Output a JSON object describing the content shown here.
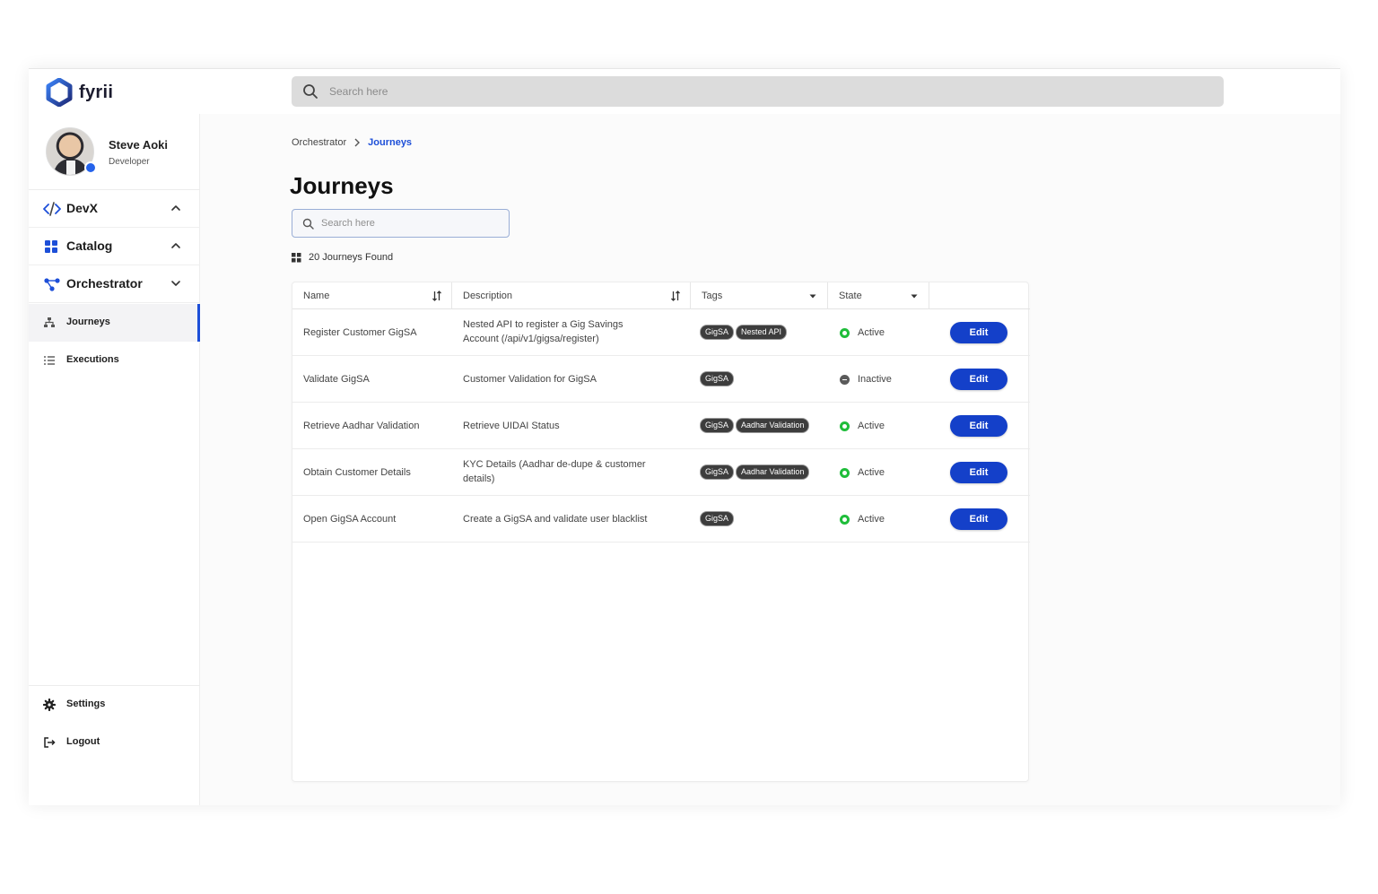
{
  "app": {
    "name": "fyrii"
  },
  "header": {
    "search_placeholder": "Search here"
  },
  "profile": {
    "name": "Steve Aoki",
    "role": "Developer"
  },
  "sidebar": {
    "groups": [
      {
        "label": "DevX",
        "icon": "code-icon",
        "expanded": true
      },
      {
        "label": "Catalog",
        "icon": "grid-icon",
        "expanded": true
      },
      {
        "label": "Orchestrator",
        "icon": "workflow-icon",
        "expanded": false
      }
    ],
    "items": [
      {
        "label": "Journeys",
        "icon": "hierarchy-icon",
        "active": true
      },
      {
        "label": "Executions",
        "icon": "list-icon",
        "active": false
      }
    ],
    "bottom": [
      {
        "label": "Settings",
        "icon": "gear-icon"
      },
      {
        "label": "Logout",
        "icon": "logout-icon"
      }
    ]
  },
  "breadcrumb": {
    "parent": "Orchestrator",
    "separator": ">",
    "current": "Journeys"
  },
  "page": {
    "title": "Journeys",
    "search_placeholder": "Search here",
    "count_text": "20 Journeys Found"
  },
  "table": {
    "columns": [
      "Name",
      "Description",
      "Tags",
      "State",
      ""
    ],
    "edit_label": "Edit",
    "rows": [
      {
        "name": "Register Customer GigSA",
        "description_lines": [
          "Nested API to register a Gig Savings",
          "Account (/api/v1/gigsa/register)"
        ],
        "tags": [
          "GigSA",
          "Nested API"
        ],
        "state": "Active"
      },
      {
        "name": "Validate GigSA",
        "description_lines": [
          "Customer Validation for GigSA"
        ],
        "tags": [
          "GigSA"
        ],
        "state": "Inactive"
      },
      {
        "name": "Retrieve Aadhar Validation",
        "description_lines": [
          "Retrieve UIDAI Status"
        ],
        "tags": [
          "GigSA",
          "Aadhar Validation"
        ],
        "state": "Active"
      },
      {
        "name": "Obtain Customer Details",
        "description_lines": [
          "KYC Details (Aadhar de-dupe & customer",
          "details)"
        ],
        "tags": [
          "GigSA",
          "Aadhar Validation"
        ],
        "state": "Active"
      },
      {
        "name": "Open GigSA Account",
        "description_lines": [
          "Create a GigSA and validate user blacklist"
        ],
        "tags": [
          "GigSA"
        ],
        "state": "Active"
      }
    ]
  },
  "colors": {
    "accent": "#1440c9",
    "active_state": "#1fbd3a",
    "inactive_state": "#5a5a5a",
    "tag_bg": "#3d3d3d"
  }
}
